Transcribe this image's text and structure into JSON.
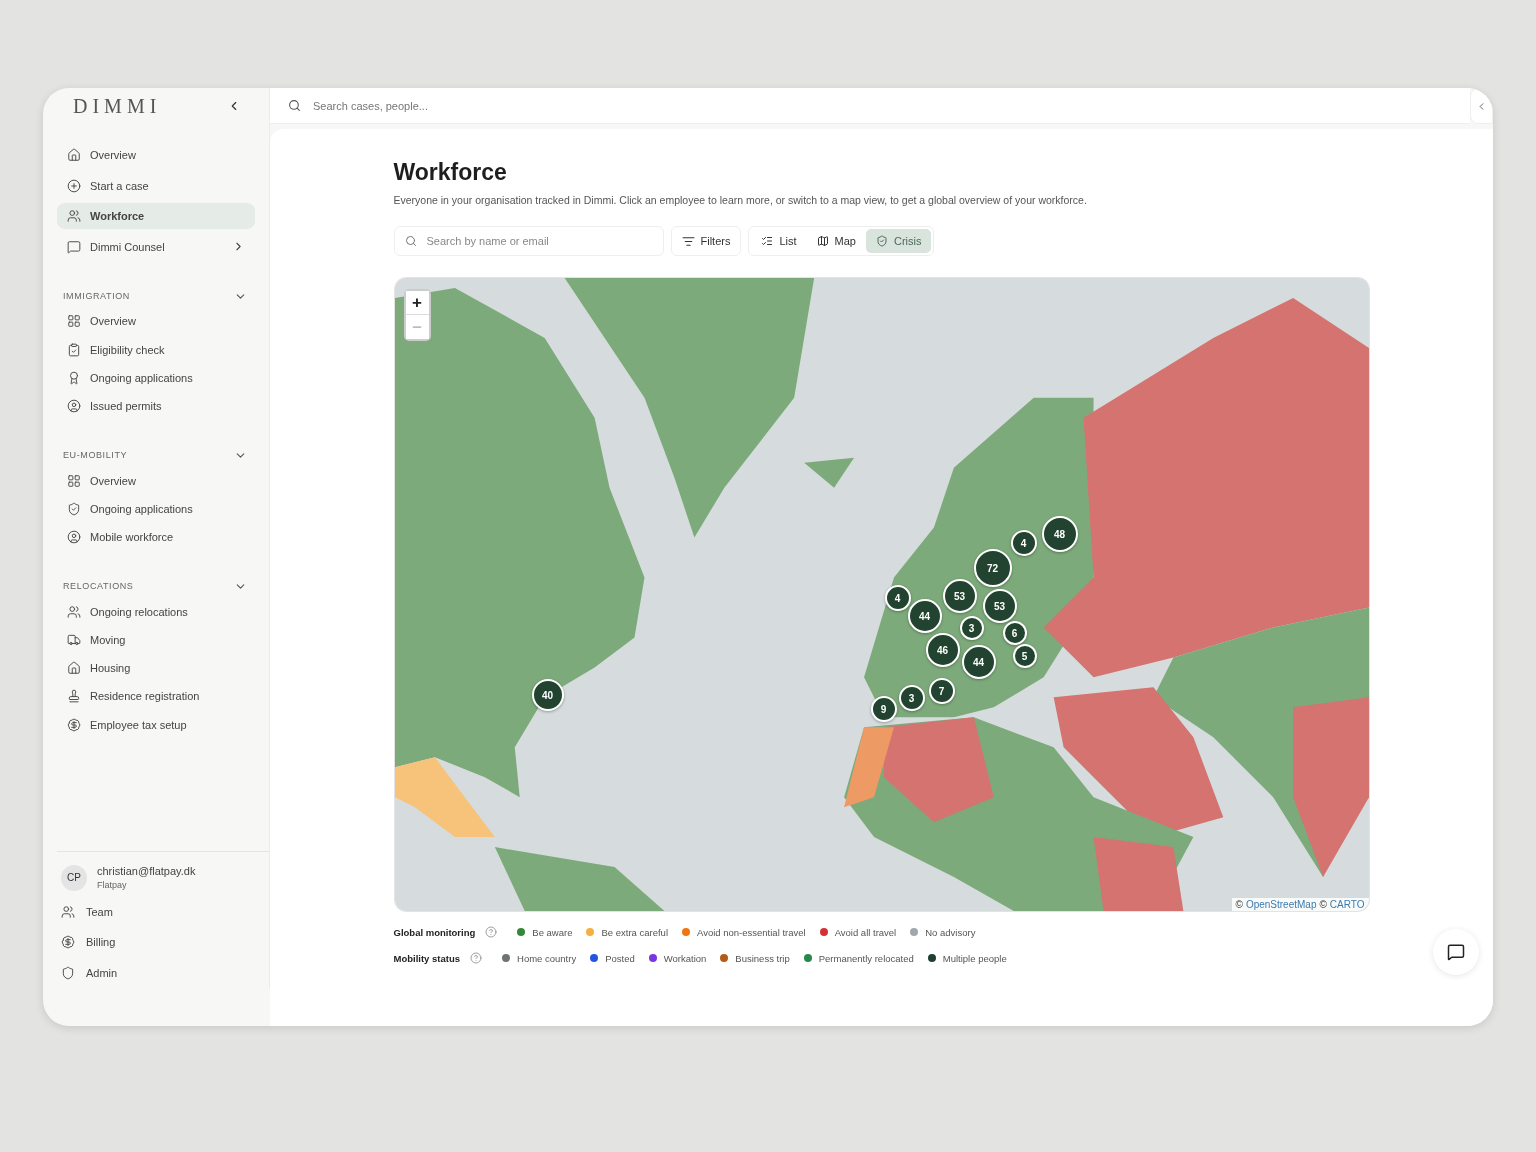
{
  "sidebar": {
    "logo": "DIMMI",
    "nav": [
      {
        "label": "Overview",
        "selected": false,
        "has_submenu": false
      },
      {
        "label": "Start a case",
        "selected": false,
        "has_submenu": false
      },
      {
        "label": "Workforce",
        "selected": true,
        "has_submenu": false
      },
      {
        "label": "Dimmi Counsel",
        "selected": false,
        "has_submenu": true
      }
    ],
    "sections": [
      {
        "title": "IMMIGRATION",
        "expanded": true,
        "items": [
          {
            "label": "Overview"
          },
          {
            "label": "Eligibility check"
          },
          {
            "label": "Ongoing applications"
          },
          {
            "label": "Issued permits"
          }
        ]
      },
      {
        "title": "EU-MOBILITY",
        "expanded": true,
        "items": [
          {
            "label": "Overview"
          },
          {
            "label": "Ongoing applications"
          },
          {
            "label": "Mobile workforce"
          }
        ]
      },
      {
        "title": "RELOCATIONS",
        "expanded": true,
        "items": [
          {
            "label": "Ongoing relocations"
          },
          {
            "label": "Moving"
          },
          {
            "label": "Housing"
          },
          {
            "label": "Residence registration"
          },
          {
            "label": "Employee tax setup"
          }
        ]
      }
    ],
    "user": {
      "initials": "CP",
      "email": "christian@flatpay.dk",
      "company": "Flatpay"
    },
    "footer": [
      {
        "label": "Team"
      },
      {
        "label": "Billing"
      },
      {
        "label": "Admin"
      }
    ]
  },
  "topbar": {
    "search_placeholder": "Search cases, people..."
  },
  "page": {
    "title": "Workforce",
    "subtitle": "Everyone in your organisation tracked in Dimmi. Click an employee to learn more, or switch to a map view, to get a global overview of your workforce.",
    "search_placeholder": "Search by name or email",
    "filters": "Filters",
    "views": [
      {
        "label": "List",
        "selected": false
      },
      {
        "label": "Map",
        "selected": false
      },
      {
        "label": "Crisis",
        "selected": true
      }
    ]
  },
  "map": {
    "zoom_in": "+",
    "zoom_out": "–",
    "attribution_prefix": "©",
    "attribution_osm": "OpenStreetMap",
    "attribution_sep": "©",
    "attribution_carto": "CARTO",
    "clusters": [
      {
        "count": "40"
      },
      {
        "count": "9"
      },
      {
        "count": "3"
      },
      {
        "count": "7"
      },
      {
        "count": "4"
      },
      {
        "count": "53"
      },
      {
        "count": "44"
      },
      {
        "count": "3"
      },
      {
        "count": "46"
      },
      {
        "count": "44"
      },
      {
        "count": "72"
      },
      {
        "count": "53"
      },
      {
        "count": "6"
      },
      {
        "count": "5"
      },
      {
        "count": "4"
      },
      {
        "count": "48"
      }
    ]
  },
  "legend": [
    {
      "title": "Global monitoring",
      "items": [
        {
          "label": "Be aware",
          "color": "#33883a"
        },
        {
          "label": "Be extra careful",
          "color": "#f6b041"
        },
        {
          "label": "Avoid non-essential travel",
          "color": "#ee7512"
        },
        {
          "label": "Avoid all travel",
          "color": "#d23232"
        },
        {
          "label": "No advisory",
          "color": "#a2a6ae"
        }
      ]
    },
    {
      "title": "Mobility status",
      "items": [
        {
          "label": "Home country",
          "color": "#6c7570"
        },
        {
          "label": "Posted",
          "color": "#2455e0"
        },
        {
          "label": "Workation",
          "color": "#7a36e0"
        },
        {
          "label": "Business trip",
          "color": "#b55a16"
        },
        {
          "label": "Permanently relocated",
          "color": "#27884a"
        },
        {
          "label": "Multiple people",
          "color": "#1f3f30"
        }
      ]
    }
  ]
}
